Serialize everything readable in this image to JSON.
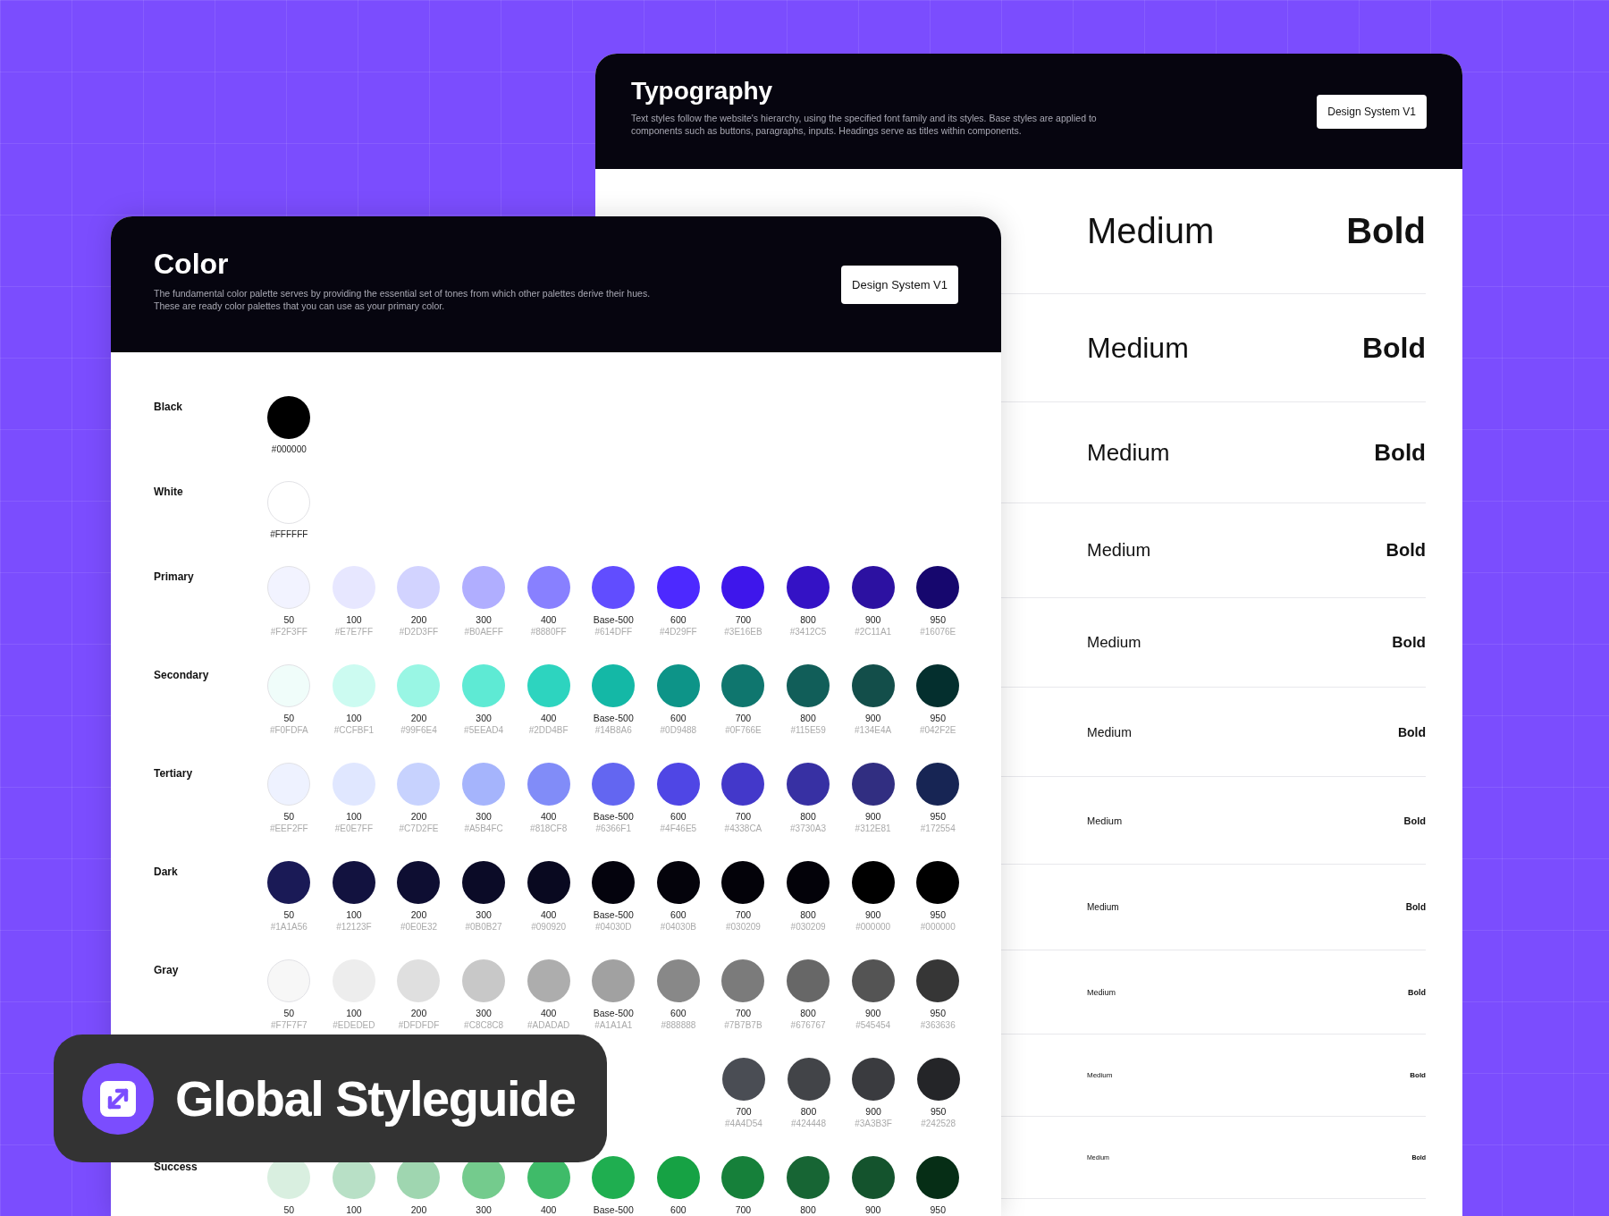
{
  "typography": {
    "title": "Typography",
    "description": "Text styles follow the website's hierarchy, using the specified font family and its styles. Base styles are applied to components such as buttons, paragraphs, inputs. Headings serve as titles within components.",
    "button": "Design System V1",
    "rows": [
      {
        "medium": "Medium",
        "bold": "Bold"
      },
      {
        "medium": "Medium",
        "bold": "Bold"
      },
      {
        "medium": "Medium",
        "bold": "Bold"
      },
      {
        "medium": "Medium",
        "bold": "Bold"
      },
      {
        "medium": "Medium",
        "bold": "Bold"
      },
      {
        "medium": "Medium",
        "bold": "Bold"
      },
      {
        "medium": "Medium",
        "bold": "Bold"
      },
      {
        "medium": "Medium",
        "bold": "Bold"
      },
      {
        "medium": "Medium",
        "bold": "Bold"
      },
      {
        "medium": "Medium",
        "bold": "Bold"
      },
      {
        "medium": "Medium",
        "bold": "Bold"
      }
    ]
  },
  "color": {
    "title": "Color",
    "description": "The fundamental color palette serves by providing the essential set of tones from which other palettes derive their hues. These are ready color palettes that you can use as your primary color.",
    "button": "Design System V1",
    "rows": [
      {
        "name": "Black",
        "swatches": [
          {
            "hex": "#000000",
            "color": "#000000"
          }
        ]
      },
      {
        "name": "White",
        "swatches": [
          {
            "hex": "#FFFFFF",
            "color": "#ffffff"
          }
        ]
      },
      {
        "name": "Primary",
        "swatches": [
          {
            "label": "50",
            "hex": "#F2F3FF",
            "color": "#f2f3ff"
          },
          {
            "label": "100",
            "hex": "#E7E7FF",
            "color": "#e7e7ff"
          },
          {
            "label": "200",
            "hex": "#D2D3FF",
            "color": "#d2d3ff"
          },
          {
            "label": "300",
            "hex": "#B0AEFF",
            "color": "#b0aeff"
          },
          {
            "label": "400",
            "hex": "#8880FF",
            "color": "#8880ff"
          },
          {
            "label": "Base-500",
            "hex": "#614DFF",
            "color": "#614dff"
          },
          {
            "label": "600",
            "hex": "#4D29FF",
            "color": "#4d29ff"
          },
          {
            "label": "700",
            "hex": "#3E16EB",
            "color": "#3e16eb"
          },
          {
            "label": "800",
            "hex": "#3412C5",
            "color": "#3412c5"
          },
          {
            "label": "900",
            "hex": "#2C11A1",
            "color": "#2c11a1"
          },
          {
            "label": "950",
            "hex": "#16076E",
            "color": "#16076e"
          }
        ]
      },
      {
        "name": "Secondary",
        "swatches": [
          {
            "label": "50",
            "hex": "#F0FDFA",
            "color": "#f0fdfa"
          },
          {
            "label": "100",
            "hex": "#CCFBF1",
            "color": "#ccfbf1"
          },
          {
            "label": "200",
            "hex": "#99F6E4",
            "color": "#99f6e4"
          },
          {
            "label": "300",
            "hex": "#5EEAD4",
            "color": "#5eead4"
          },
          {
            "label": "400",
            "hex": "#2DD4BF",
            "color": "#2dd4bf"
          },
          {
            "label": "Base-500",
            "hex": "#14B8A6",
            "color": "#14b8a6"
          },
          {
            "label": "600",
            "hex": "#0D9488",
            "color": "#0d9488"
          },
          {
            "label": "700",
            "hex": "#0F766E",
            "color": "#0f766e"
          },
          {
            "label": "800",
            "hex": "#115E59",
            "color": "#115e59"
          },
          {
            "label": "900",
            "hex": "#134E4A",
            "color": "#134e4a"
          },
          {
            "label": "950",
            "hex": "#042F2E",
            "color": "#042f2e"
          }
        ]
      },
      {
        "name": "Tertiary",
        "swatches": [
          {
            "label": "50",
            "hex": "#EEF2FF",
            "color": "#eef2ff"
          },
          {
            "label": "100",
            "hex": "#E0E7FF",
            "color": "#e0e7ff"
          },
          {
            "label": "200",
            "hex": "#C7D2FE",
            "color": "#c7d2fe"
          },
          {
            "label": "300",
            "hex": "#A5B4FC",
            "color": "#a5b4fc"
          },
          {
            "label": "400",
            "hex": "#818CF8",
            "color": "#818cf8"
          },
          {
            "label": "Base-500",
            "hex": "#6366F1",
            "color": "#6366f1"
          },
          {
            "label": "600",
            "hex": "#4F46E5",
            "color": "#4f46e5"
          },
          {
            "label": "700",
            "hex": "#4338CA",
            "color": "#4338ca"
          },
          {
            "label": "800",
            "hex": "#3730A3",
            "color": "#3730a3"
          },
          {
            "label": "900",
            "hex": "#312E81",
            "color": "#312e81"
          },
          {
            "label": "950",
            "hex": "#172554",
            "color": "#172554"
          }
        ]
      },
      {
        "name": "Dark",
        "swatches": [
          {
            "label": "50",
            "hex": "#1A1A56",
            "color": "#1a1a56"
          },
          {
            "label": "100",
            "hex": "#12123F",
            "color": "#12123f"
          },
          {
            "label": "200",
            "hex": "#0E0E32",
            "color": "#0e0e32"
          },
          {
            "label": "300",
            "hex": "#0B0B27",
            "color": "#0b0b27"
          },
          {
            "label": "400",
            "hex": "#090920",
            "color": "#090920"
          },
          {
            "label": "Base-500",
            "hex": "#04030D",
            "color": "#04030d"
          },
          {
            "label": "600",
            "hex": "#04030B",
            "color": "#04030b"
          },
          {
            "label": "700",
            "hex": "#030209",
            "color": "#030209"
          },
          {
            "label": "800",
            "hex": "#030209",
            "color": "#030209"
          },
          {
            "label": "900",
            "hex": "#000000",
            "color": "#000000"
          },
          {
            "label": "950",
            "hex": "#000000",
            "color": "#000000"
          }
        ]
      },
      {
        "name": "Gray",
        "swatches": [
          {
            "label": "50",
            "hex": "#F7F7F7",
            "color": "#f7f7f7"
          },
          {
            "label": "100",
            "hex": "#EDEDED",
            "color": "#ededed"
          },
          {
            "label": "200",
            "hex": "#DFDFDF",
            "color": "#dfdfdf"
          },
          {
            "label": "300",
            "hex": "#C8C8C8",
            "color": "#c8c8c8"
          },
          {
            "label": "400",
            "hex": "#ADADAD",
            "color": "#adadad"
          },
          {
            "label": "Base-500",
            "hex": "#A1A1A1",
            "color": "#a1a1a1"
          },
          {
            "label": "600",
            "hex": "#888888",
            "color": "#888888"
          },
          {
            "label": "700",
            "hex": "#7B7B7B",
            "color": "#7b7b7b"
          },
          {
            "label": "800",
            "hex": "#676767",
            "color": "#676767"
          },
          {
            "label": "900",
            "hex": "#545454",
            "color": "#545454"
          },
          {
            "label": "950",
            "hex": "#363636",
            "color": "#363636"
          }
        ]
      },
      {
        "swatches": [
          {
            "label": "700",
            "hex": "#4A4D54",
            "color": "#4a4d54"
          },
          {
            "label": "800",
            "hex": "#424448",
            "color": "#424448"
          },
          {
            "label": "900",
            "hex": "#3A3B3F",
            "color": "#3a3b3f"
          },
          {
            "label": "950",
            "hex": "#242528",
            "color": "#242528"
          }
        ]
      },
      {
        "name": "Success",
        "swatches": [
          {
            "label": "50",
            "color": "#d9efe0"
          },
          {
            "label": "100",
            "color": "#b8e0c6"
          },
          {
            "label": "200",
            "color": "#9fd6b0"
          },
          {
            "label": "300",
            "color": "#74cb8d"
          },
          {
            "label": "400",
            "color": "#3fbb69"
          },
          {
            "label": "Base-500",
            "color": "#1fae50"
          },
          {
            "label": "600",
            "color": "#16a244"
          },
          {
            "label": "700",
            "color": "#16803a"
          },
          {
            "label": "800",
            "color": "#176534"
          },
          {
            "label": "900",
            "color": "#14532d"
          },
          {
            "label": "950",
            "color": "#062e16"
          }
        ]
      }
    ]
  },
  "banner": {
    "title": "Global Styleguide"
  }
}
